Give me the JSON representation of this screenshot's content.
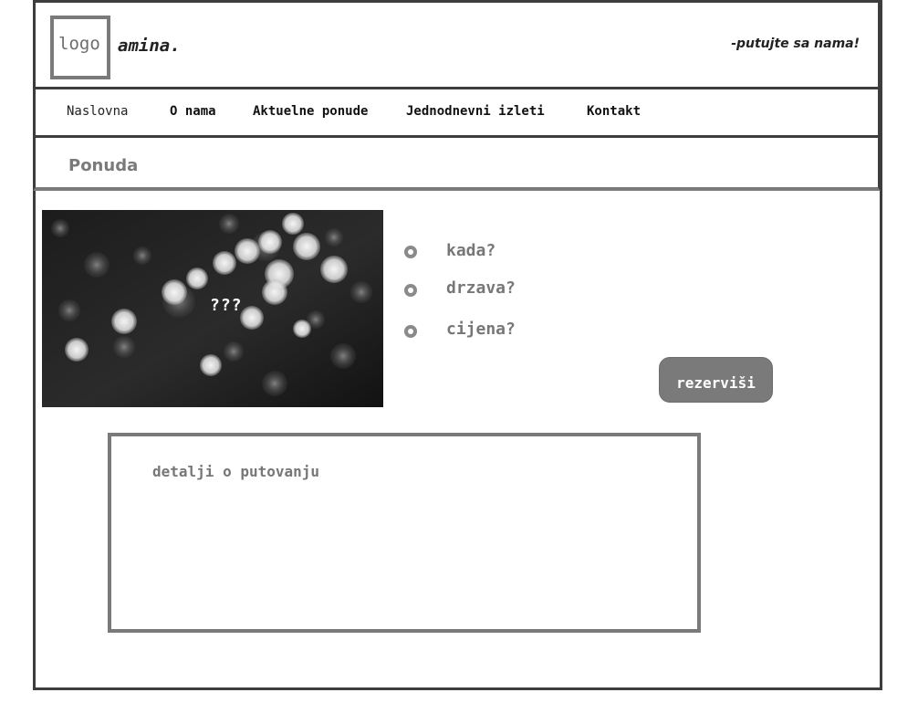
{
  "header": {
    "logo": "logo",
    "brand": "amina.",
    "slogan": "-putujte sa nama!"
  },
  "nav": {
    "items": [
      {
        "label": "Naslovna"
      },
      {
        "label": "O nama"
      },
      {
        "label": "Aktuelne ponude"
      },
      {
        "label": "Jednodnevni izleti"
      },
      {
        "label": "Kontakt"
      }
    ]
  },
  "page": {
    "title": "Ponuda"
  },
  "offer": {
    "image_caption": "???",
    "details": [
      {
        "label": "kada?"
      },
      {
        "label": "drzava?"
      },
      {
        "label": "cijena?"
      }
    ],
    "reserve_label": "rezerviši",
    "description_label": "detalji o putovanju"
  },
  "colors": {
    "border_dark": "#3d3d3d",
    "border_gray": "#7a7a7a",
    "button_bg": "#7a7a7a",
    "text_gray": "#777777"
  }
}
